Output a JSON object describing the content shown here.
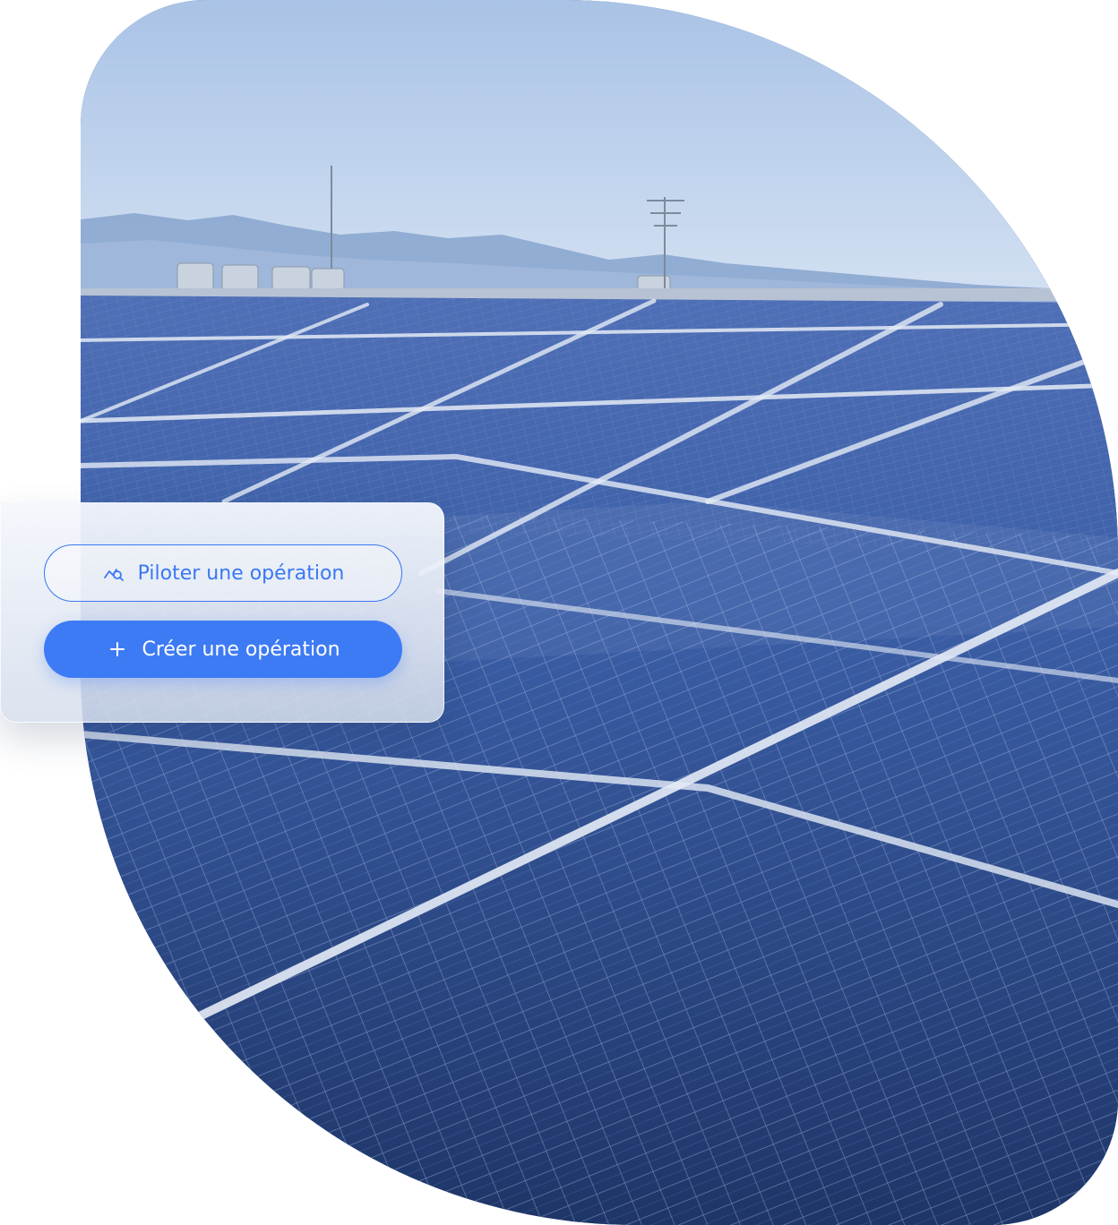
{
  "actions": {
    "monitor": {
      "label": "Piloter une opération",
      "icon": "chart-search-icon",
      "color": "#3a78f2"
    },
    "create": {
      "label": "Créer une opération",
      "icon": "plus-icon",
      "color": "#3d7bf4"
    }
  },
  "hero": {
    "icon": "solar-panels-photo"
  }
}
